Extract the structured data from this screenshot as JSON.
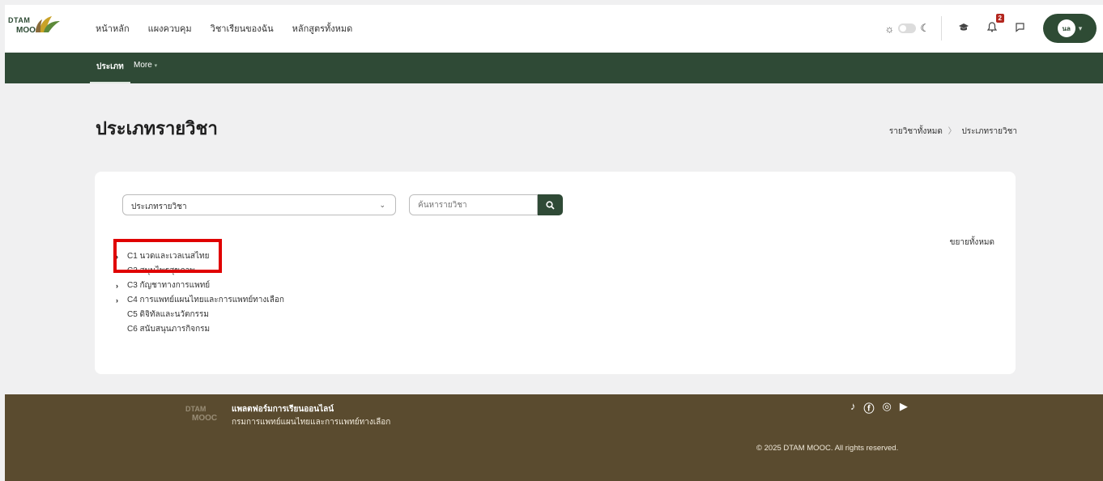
{
  "logo": {
    "line1": "DTAM",
    "line2": "MOOC"
  },
  "nav": {
    "items": [
      {
        "label": "หน้าหลัก"
      },
      {
        "label": "แผงควบคุม"
      },
      {
        "label": "วิชาเรียนของฉัน"
      },
      {
        "label": "หลักสูตรทั้งหมด"
      }
    ]
  },
  "header": {
    "notification_count": "2",
    "avatar_initials": "นล",
    "icons": [
      "sun-icon",
      "moon-icon",
      "graduation-cap-icon",
      "bell-icon",
      "chat-icon"
    ]
  },
  "subnav": {
    "active_tab": "ประเภท",
    "more_label": "More"
  },
  "page": {
    "title": "ประเภทรายวิชา",
    "breadcrumb": [
      "รายวิชาทั้งหมด",
      "ประเภทรายวิชา"
    ]
  },
  "filters": {
    "select_value": "ประเภทรายวิชา",
    "search_placeholder": "ค้นหารายวิชา"
  },
  "expand_all_label": "ขยายทั้งหมด",
  "categories": [
    {
      "label": "C1 นวดและเวลเนสไทย",
      "expandable": true
    },
    {
      "label": "C2 สมุนไพรสุขภาพ",
      "expandable": false
    },
    {
      "label": "C3 กัญชาทางการแพทย์",
      "expandable": true
    },
    {
      "label": "C4 การแพทย์แผนไทยและการแพทย์ทางเลือก",
      "expandable": true
    },
    {
      "label": "C5 ดิจิทัลและนวัตกรรม",
      "expandable": false
    },
    {
      "label": "C6 สนับสนุนภารกิจกรม",
      "expandable": false
    }
  ],
  "footer": {
    "logo_line1": "DTAM",
    "logo_line2": "MOOC",
    "title": "แพลตฟอร์มการเรียนออนไลน์",
    "subtitle": "กรมการแพทย์แผนไทยและการแพทย์ทางเลือก",
    "copyright": "© 2025 DTAM MOOC. All rights reserved.",
    "social_icons": [
      "tiktok-icon",
      "facebook-icon",
      "instagram-icon",
      "youtube-icon"
    ]
  },
  "colors": {
    "brand_green": "#2f4a36",
    "footer_brown": "#5a4b2f",
    "highlight_red": "#e00000"
  }
}
